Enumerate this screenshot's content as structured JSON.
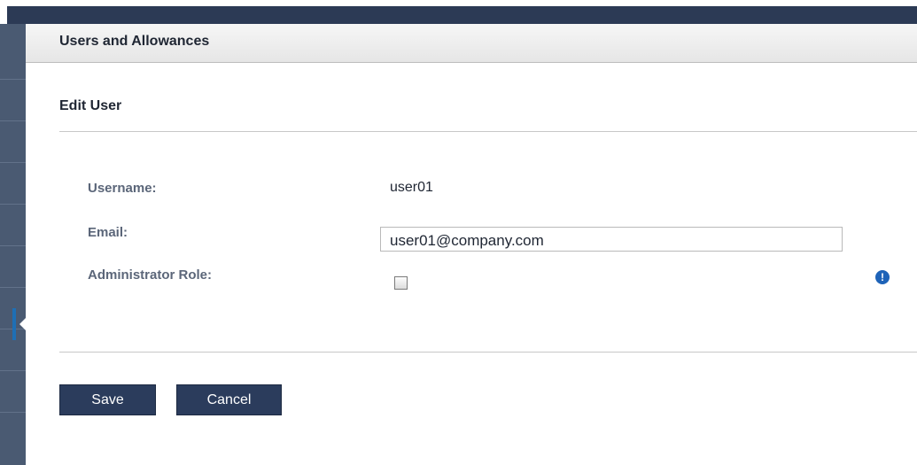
{
  "header": {
    "title": "Users and Allowances"
  },
  "form": {
    "section_title": "Edit User",
    "username": {
      "label": "Username:",
      "value": "user01"
    },
    "email": {
      "label": "Email:",
      "value": "user01@company.com"
    },
    "admin_role": {
      "label": "Administrator Role:",
      "checked": false,
      "info_icon": "info-icon",
      "info_glyph": "!"
    }
  },
  "actions": {
    "save_label": "Save",
    "cancel_label": "Cancel"
  },
  "colors": {
    "sidebar": "#4a5a72",
    "button": "#2b3c5c",
    "info": "#1e63b8"
  }
}
